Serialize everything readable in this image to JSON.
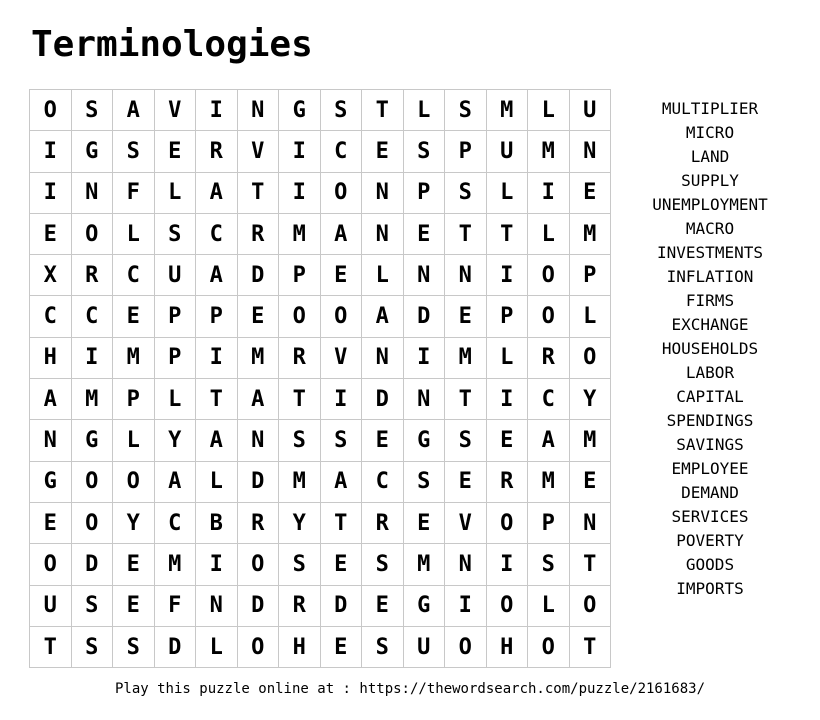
{
  "title": "Terminologies",
  "grid": [
    [
      "O",
      "S",
      "A",
      "V",
      "I",
      "N",
      "G",
      "S",
      "T",
      "L",
      "S",
      "M",
      "L",
      "U"
    ],
    [
      "I",
      "G",
      "S",
      "E",
      "R",
      "V",
      "I",
      "C",
      "E",
      "S",
      "P",
      "U",
      "M",
      "N"
    ],
    [
      "I",
      "N",
      "F",
      "L",
      "A",
      "T",
      "I",
      "O",
      "N",
      "P",
      "S",
      "L",
      "I",
      "E"
    ],
    [
      "E",
      "O",
      "L",
      "S",
      "C",
      "R",
      "M",
      "A",
      "N",
      "E",
      "T",
      "T",
      "L",
      "M"
    ],
    [
      "X",
      "R",
      "C",
      "U",
      "A",
      "D",
      "P",
      "E",
      "L",
      "N",
      "N",
      "I",
      "O",
      "P"
    ],
    [
      "C",
      "C",
      "E",
      "P",
      "P",
      "E",
      "O",
      "O",
      "A",
      "D",
      "E",
      "P",
      "O",
      "L"
    ],
    [
      "H",
      "I",
      "M",
      "P",
      "I",
      "M",
      "R",
      "V",
      "N",
      "I",
      "M",
      "L",
      "R",
      "O"
    ],
    [
      "A",
      "M",
      "P",
      "L",
      "T",
      "A",
      "T",
      "I",
      "D",
      "N",
      "T",
      "I",
      "C",
      "Y"
    ],
    [
      "N",
      "G",
      "L",
      "Y",
      "A",
      "N",
      "S",
      "S",
      "E",
      "G",
      "S",
      "E",
      "A",
      "M"
    ],
    [
      "G",
      "O",
      "O",
      "A",
      "L",
      "D",
      "M",
      "A",
      "C",
      "S",
      "E",
      "R",
      "M",
      "E"
    ],
    [
      "E",
      "O",
      "Y",
      "C",
      "B",
      "R",
      "Y",
      "T",
      "R",
      "E",
      "V",
      "O",
      "P",
      "N"
    ],
    [
      "O",
      "D",
      "E",
      "M",
      "I",
      "O",
      "S",
      "E",
      "S",
      "M",
      "N",
      "I",
      "S",
      "T"
    ],
    [
      "U",
      "S",
      "E",
      "F",
      "N",
      "D",
      "R",
      "D",
      "E",
      "G",
      "I",
      "O",
      "L",
      "O"
    ],
    [
      "T",
      "S",
      "S",
      "D",
      "L",
      "O",
      "H",
      "E",
      "S",
      "U",
      "O",
      "H",
      "O",
      "T"
    ]
  ],
  "words": [
    "MULTIPLIER",
    "MICRO",
    "LAND",
    "SUPPLY",
    "UNEMPLOYMENT",
    "MACRO",
    "INVESTMENTS",
    "INFLATION",
    "FIRMS",
    "EXCHANGE",
    "HOUSEHOLDS",
    "LABOR",
    "CAPITAL",
    "SPENDINGS",
    "SAVINGS",
    "EMPLOYEE",
    "DEMAND",
    "SERVICES",
    "POVERTY",
    "GOODS",
    "IMPORTS"
  ],
  "footer": "Play this puzzle online at : https://thewordsearch.com/puzzle/2161683/"
}
